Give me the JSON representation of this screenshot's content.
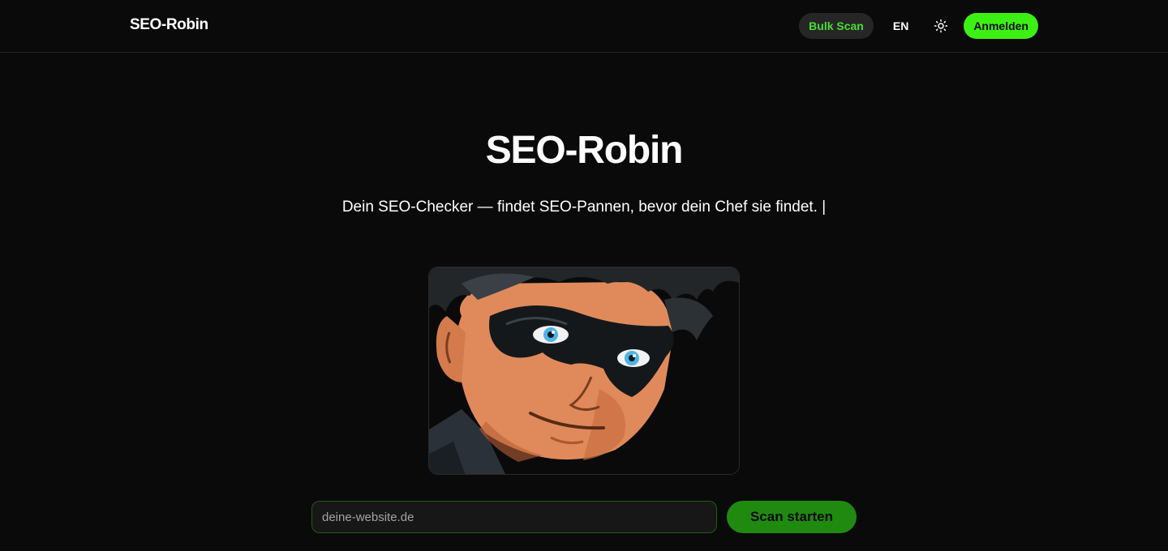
{
  "header": {
    "logo": "SEO-Robin",
    "bulk_scan": "Bulk Scan",
    "language": "EN",
    "theme_icon": "sun-icon",
    "login": "Anmelden"
  },
  "hero": {
    "title": "SEO-Robin",
    "tagline_prefix": "Dein SEO-Checker — ",
    "tagline_main": "findet SEO-Pannen, bevor dein Chef sie findet.",
    "cursor": " |",
    "image_subject": "masked-hero-illustration"
  },
  "scan": {
    "placeholder": "deine-website.de",
    "button": "Scan starten"
  },
  "colors": {
    "background": "#0a0a0a",
    "accent": "#3cf014",
    "accent_text": "#4ade30",
    "scan_button": "#1f8a0f"
  }
}
